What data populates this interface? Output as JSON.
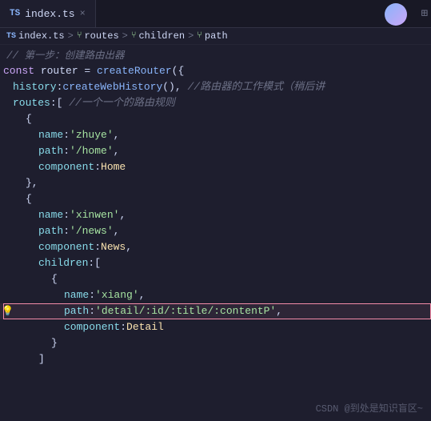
{
  "tab": {
    "ts_label": "TS",
    "filename": "index.ts",
    "close_symbol": "×"
  },
  "breadcrumb": {
    "ts_label": "TS",
    "file": "index.ts",
    "sep": ">",
    "items": [
      "routes",
      "children",
      "path"
    ]
  },
  "comment_line": {
    "text": "// 第一步：创建路由出器"
  },
  "lines": [
    {
      "content": "const router = createRouter({",
      "type": "normal"
    },
    {
      "content": "  history:createWebHistory(), //路由器的工作模式（稍后讲",
      "type": "comment-inline"
    },
    {
      "content": "  routes:[ //一个一个的路由规则",
      "type": "comment-inline"
    },
    {
      "content": "    {",
      "type": "normal"
    },
    {
      "content": "      name:'zhuye',",
      "type": "normal"
    },
    {
      "content": "      path:'/home',",
      "type": "normal"
    },
    {
      "content": "      component:Home",
      "type": "normal"
    },
    {
      "content": "    },",
      "type": "normal"
    },
    {
      "content": "    {",
      "type": "normal"
    },
    {
      "content": "      name:'xinwen',",
      "type": "normal"
    },
    {
      "content": "      path:'/news',",
      "type": "normal"
    },
    {
      "content": "      component:News,",
      "type": "normal"
    },
    {
      "content": "      children:[",
      "type": "normal"
    },
    {
      "content": "        {",
      "type": "normal"
    },
    {
      "content": "          name:'xiang',",
      "type": "normal"
    },
    {
      "content": "          path:'detail/:id/:title/:contentP',",
      "type": "highlight"
    },
    {
      "content": "          component:Detail",
      "type": "normal"
    },
    {
      "content": "        }",
      "type": "normal"
    },
    {
      "content": "      ]",
      "type": "normal"
    }
  ],
  "watermark": "CSDN @到处是知识盲区~",
  "lightbulb_symbol": "💡",
  "colors": {
    "keyword": "#cba6f7",
    "function": "#89b4fa",
    "string": "#a6e3a1",
    "property": "#89dceb",
    "comment": "#6c7086",
    "highlight_border": "#f38ba8",
    "plain": "#cdd6f4"
  }
}
